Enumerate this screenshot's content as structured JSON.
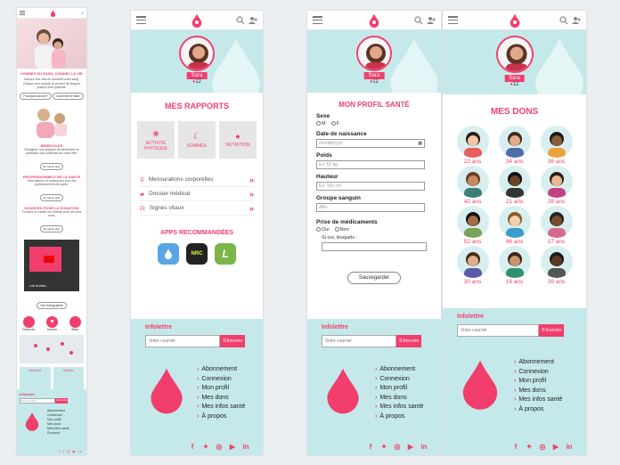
{
  "colors": {
    "accent": "#f13e6c",
    "teal": "#c5e9ea",
    "grey": "#e6e6e6"
  },
  "home": {
    "hero_title": "DONNEZ DU SANG, DONNEZ LA VIE",
    "hero_text": "Sauvez des vies en donnant votre sang. Chaque don compte et permet de soigner jusqu'à trois patients.",
    "btn_left": "Pourquoi donner?",
    "btn_right": "Comment le faire",
    "sec1_title": "BENEVOLES",
    "sec1_text": "Rejoignez nos équipes de bénévoles et participez aux collectes de votre ville.",
    "sec1_link": "En savoir plus",
    "sec2_title": "PROFESSIONNELS DE LA SANTE",
    "sec2_text": "Informations et ressources pour les professionnels de santé.",
    "sec2_link": "En savoir plus",
    "sec3_title": "SOURCES POUR LA DONATION",
    "sec3_text": "Trouvez un centre de collecte près de chez vous.",
    "sec3_link": "En savoir plus",
    "video_label": "Lire la vidéo",
    "video_caption": "Voir l'infographie",
    "actions": [
      "Réserver",
      "Donner",
      "Aider"
    ],
    "cards": [
      "Montréal",
      "Québec"
    ],
    "newsletter_title": "Infolettre",
    "newsletter_placeholder": "Votre courriel",
    "newsletter_btn": "S'inscrire",
    "links": [
      "Abonnement",
      "Connexion",
      "Mon profil",
      "Mes dons",
      "Mes infos santé",
      "À propos"
    ]
  },
  "rapports": {
    "user_name": "Sara",
    "drops": "12",
    "title": "MES RAPPORTS",
    "categories": [
      {
        "icon": "paw-icon",
        "label": "ACTIVITÉ PHYSIQUE"
      },
      {
        "icon": "moon-icon",
        "label": "SOMMEIL"
      },
      {
        "icon": "apple-icon",
        "label": "NUTRITION"
      }
    ],
    "rows": [
      {
        "icon": "body-icon",
        "label": "Mensurations corporelles"
      },
      {
        "icon": "folder-icon",
        "label": "Dossier médical"
      },
      {
        "icon": "stethoscope-icon",
        "label": "Signes vitaux"
      }
    ],
    "apps_title": "APPS RECOMMANDÉES",
    "apps": [
      {
        "name": "drop-app",
        "color": "#5aa5e6",
        "label": "💧"
      },
      {
        "name": "nike-run-club",
        "color": "#222222",
        "label": "NRC"
      },
      {
        "name": "lifesum",
        "color": "#7ab648",
        "label": "L"
      }
    ]
  },
  "profil": {
    "user_name": "Sara",
    "drops": "12",
    "title": "MON PROFIL SANTÉ",
    "sexe_label": "Sexe",
    "sexe_opts": [
      "M",
      "F"
    ],
    "dob_label": "Date de naissance",
    "dob_placeholder": "mm/dd/yyyy",
    "poids_label": "Poids",
    "poids_placeholder": "Ex: 52 kg",
    "hauteur_label": "Hauteur",
    "hauteur_placeholder": "Ex: 160 cm",
    "groupe_label": "Groupe sanguin",
    "groupe_placeholder": "AB+",
    "meds_label": "Prise de médicaments",
    "meds_opts": [
      "Oui",
      "Non"
    ],
    "meds_which": "Si oui, lesquels :",
    "save_btn": "Sauvegarder"
  },
  "dons": {
    "user_name": "Sara",
    "drops": "12",
    "title": "MES DONS",
    "ages": [
      "22 ans",
      "34 ans",
      "36 ans",
      "42 ans",
      "21 ans",
      "28 ans",
      "52 ans",
      "46 ans",
      "17 ans",
      "30 ans",
      "18 ans",
      "39 ans"
    ]
  },
  "footer": {
    "newsletter_title": "Infolettre",
    "newsletter_placeholder": "Votre courriel",
    "newsletter_btn": "S'inscrire",
    "links": [
      "Abonnement",
      "Connexion",
      "Mon profil",
      "Mes dons",
      "Mes infos santé",
      "À propos"
    ],
    "social": [
      "facebook-icon",
      "twitter-icon",
      "instagram-icon",
      "youtube-icon",
      "linkedin-icon"
    ]
  }
}
